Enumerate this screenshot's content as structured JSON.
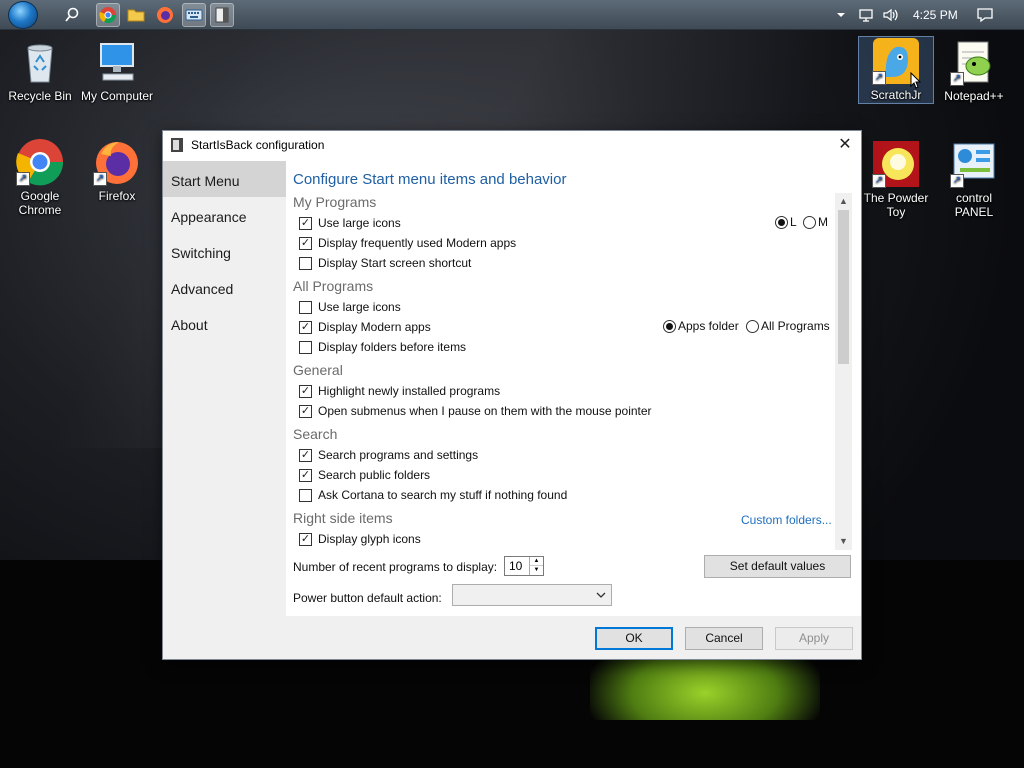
{
  "taskbar": {
    "clock": "4:25 PM",
    "icons": [
      "start-orb",
      "search-icon",
      "chrome-icon",
      "folder-icon",
      "firefox-icon",
      "keyboard-icon",
      "startisback-config-icon"
    ],
    "tray_icons": [
      "chevron-up-icon",
      "network-icon",
      "volume-icon",
      "notification-icon"
    ]
  },
  "desktop": {
    "icons": [
      {
        "label": "Recycle Bin"
      },
      {
        "label": "My Computer"
      },
      {
        "label": "Google Chrome"
      },
      {
        "label": "Firefox"
      },
      {
        "label": "ScratchJr"
      },
      {
        "label": "Notepad++"
      },
      {
        "label": "The Powder Toy"
      },
      {
        "label": "control PANEL"
      }
    ]
  },
  "dialog": {
    "title": "StartIsBack configuration",
    "close_glyph": "✕",
    "nav": [
      "Start Menu",
      "Appearance",
      "Switching",
      "Advanced",
      "About"
    ],
    "selected_nav": "Start Menu",
    "heading": "Configure Start menu items and behavior",
    "sections": {
      "my_programs": {
        "title": "My Programs",
        "options": [
          {
            "label": "Use large icons",
            "checked": true
          },
          {
            "label": "Display frequently used Modern apps",
            "checked": true
          },
          {
            "label": "Display Start screen shortcut",
            "checked": false
          }
        ],
        "size_radios": [
          {
            "label": "L",
            "selected": true
          },
          {
            "label": "M",
            "selected": false
          }
        ]
      },
      "all_programs": {
        "title": "All Programs",
        "options": [
          {
            "label": "Use large icons",
            "checked": false
          },
          {
            "label": "Display Modern apps",
            "checked": true
          },
          {
            "label": "Display folders before items",
            "checked": false
          }
        ],
        "apps_radios": [
          {
            "label": "Apps folder",
            "selected": true
          },
          {
            "label": "All Programs",
            "selected": false
          }
        ]
      },
      "general": {
        "title": "General",
        "options": [
          {
            "label": "Highlight newly installed programs",
            "checked": true
          },
          {
            "label": "Open submenus when I pause on them with the mouse pointer",
            "checked": true
          }
        ]
      },
      "search": {
        "title": "Search",
        "options": [
          {
            "label": "Search programs and settings",
            "checked": true
          },
          {
            "label": "Search public folders",
            "checked": true
          },
          {
            "label": "Ask Cortana to search my stuff if nothing found",
            "checked": false
          }
        ]
      },
      "right_side": {
        "title": "Right side items",
        "link": "Custom folders...",
        "options": [
          {
            "label": "Display glyph icons",
            "checked": true
          }
        ]
      }
    },
    "recent_label": "Number of recent programs to display:",
    "recent_value": "10",
    "set_default_button": "Set default values",
    "power_label": "Power button default action:",
    "power_value": "",
    "buttons": {
      "ok": "OK",
      "cancel": "Cancel",
      "apply": "Apply"
    }
  },
  "colors": {
    "heading": "#1f5fa3",
    "link": "#1f6fc0",
    "primary_border": "#0078d7"
  }
}
